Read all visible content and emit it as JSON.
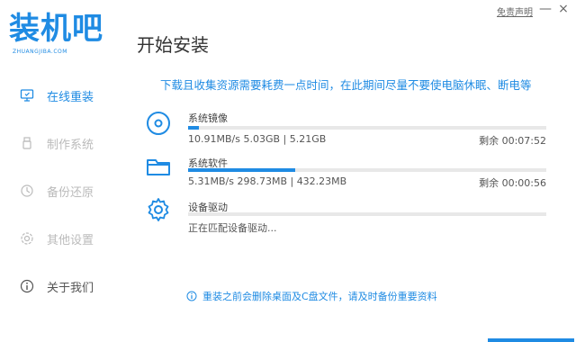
{
  "app": {
    "logo_text": "装机吧",
    "logo_sub": "ZHUANGJIBA.COM",
    "disclaimer_link": "免责声明",
    "minimize_label": "—",
    "close_label": "×"
  },
  "sidebar": {
    "items": [
      {
        "label": "在线重装",
        "icon": "monitor-icon",
        "state": "active"
      },
      {
        "label": "制作系统",
        "icon": "usb-icon",
        "state": "disabled"
      },
      {
        "label": "备份还原",
        "icon": "backup-icon",
        "state": "disabled"
      },
      {
        "label": "其他设置",
        "icon": "gear-icon",
        "state": "disabled"
      },
      {
        "label": "关于我们",
        "icon": "info-icon",
        "state": "normal"
      }
    ]
  },
  "main": {
    "title": "开始安装",
    "notice": "下载且收集资源需要耗费一点时间，在此期间尽量不要使电脑休眠、断电等",
    "tasks": [
      {
        "name": "系统镜像",
        "icon": "disc-icon",
        "stats": "10.91MB/s 5.03GB | 5.21GB",
        "remaining": "剩余 00:07:52",
        "progress": 0.03
      },
      {
        "name": "系统软件",
        "icon": "folder-icon",
        "stats": "5.31MB/s 298.73MB | 432.23MB",
        "remaining": "剩余 00:00:56",
        "progress": 0.3
      },
      {
        "name": "设备驱动",
        "icon": "gear-icon",
        "stats": "正在匹配设备驱动...",
        "remaining": "",
        "progress": 0
      }
    ],
    "footer_note": "重装之前会删除桌面及C盘文件，请及时备份重要资料"
  },
  "colors": {
    "accent": "#1f8be3",
    "track": "#e8e8e8",
    "disabled": "#bbbbbb"
  }
}
